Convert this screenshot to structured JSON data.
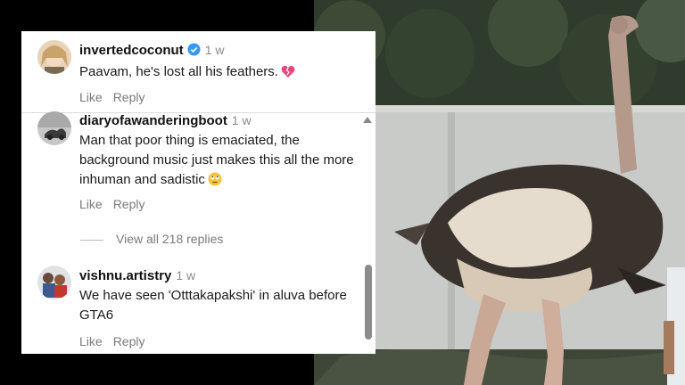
{
  "comments": [
    {
      "username": "invertedcoconut",
      "time": "1 w",
      "text": "Paavam, he's lost all his feathers.",
      "emoji_icon": "broken-heart-icon",
      "actions": {
        "like": "Like",
        "reply": "Reply"
      }
    },
    {
      "username": "diaryofawanderingboot",
      "time": "1 w",
      "text": "Man that poor thing is emaciated, the background music just makes this all the more inhuman and sadistic",
      "emoji_icon": "face-with-rolling-eyes-icon",
      "actions": {
        "like": "Like",
        "reply": "Reply"
      }
    },
    {
      "username": "vishnu.artistry",
      "time": "1 w",
      "text": "We have seen 'Otttakapakshi' in aluva before GTA6",
      "actions": {
        "like": "Like",
        "reply": "Reply"
      }
    }
  ],
  "view_replies": "View all 218 replies",
  "colors": {
    "verified": "#3897f0",
    "broken_heart": "#e8467c",
    "muted": "#7a7a7a"
  }
}
